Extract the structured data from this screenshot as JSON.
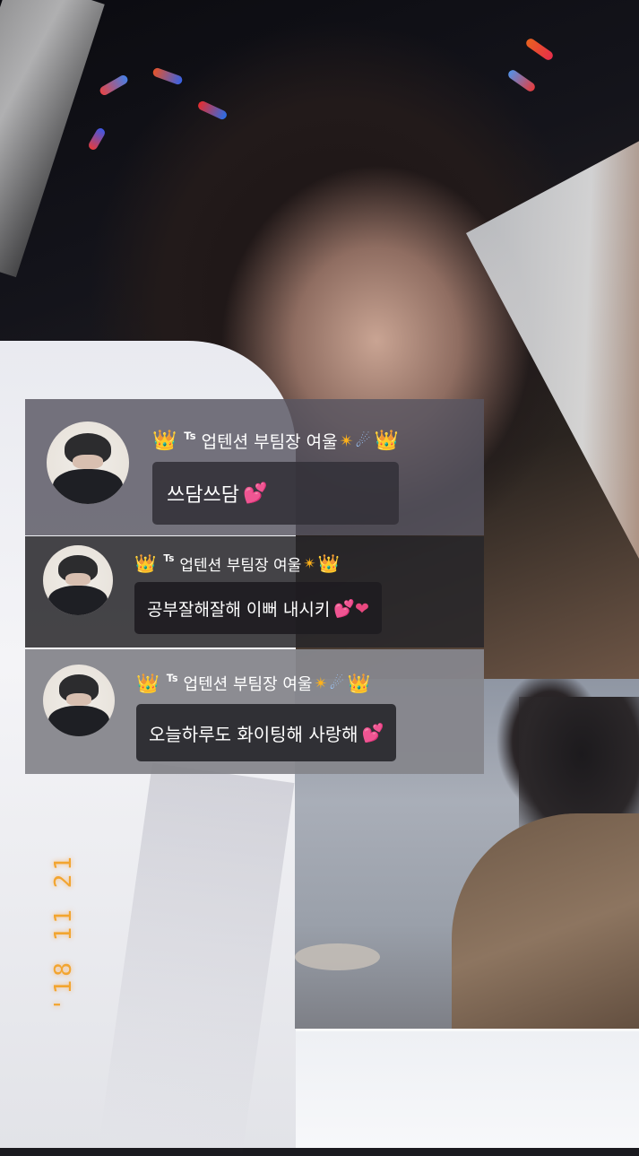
{
  "comments": [
    {
      "author": {
        "crown_left": "👑",
        "prefix": "Ts",
        "name": "업텐션 부팀장 여울",
        "sparkle": "✴",
        "star": "☄",
        "crown_right": "👑"
      },
      "message": "쓰담쓰담",
      "emoji": "💕"
    },
    {
      "author": {
        "crown_left": "👑",
        "prefix": "Ts",
        "name": "업텐션 부팀장 여울",
        "sparkle": "✴",
        "star": "",
        "crown_right": "👑"
      },
      "message": "공부잘해잘해 이뻐 내시키",
      "emoji": "💕❤"
    },
    {
      "author": {
        "crown_left": "👑",
        "prefix": "Ts",
        "name": "업텐션 부팀장 여울",
        "sparkle": "✴",
        "star": "☄",
        "crown_right": "👑"
      },
      "message": "오늘하루도 화이팅해 사랑해",
      "emoji": "💕"
    }
  ],
  "date_stamp": "'18 11 21",
  "colors": {
    "date_stamp": "#f2a530",
    "heart": "#e8487f",
    "crown": "#f7c22d"
  }
}
